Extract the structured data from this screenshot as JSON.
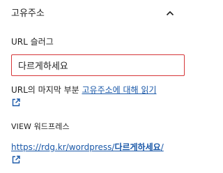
{
  "header": {
    "title": "고유주소",
    "toggle_icon": "chevron-up-icon"
  },
  "slug": {
    "label": "URL 슬러그",
    "value": "다르게하세요",
    "error_color": "#d63638"
  },
  "help": {
    "prefix": "URL의 마지막 부분 ",
    "link_text": "고유주소에 대해 읽기",
    "link_icon": "external-link-icon"
  },
  "view": {
    "label": "VIEW 워드프레스",
    "url_base": "https://rdg.kr/wordpress/",
    "url_slug": "다르게하세요",
    "url_suffix": "/",
    "link_icon": "external-link-icon"
  },
  "colors": {
    "link": "#1a58a8",
    "text": "#1e1e1e"
  }
}
